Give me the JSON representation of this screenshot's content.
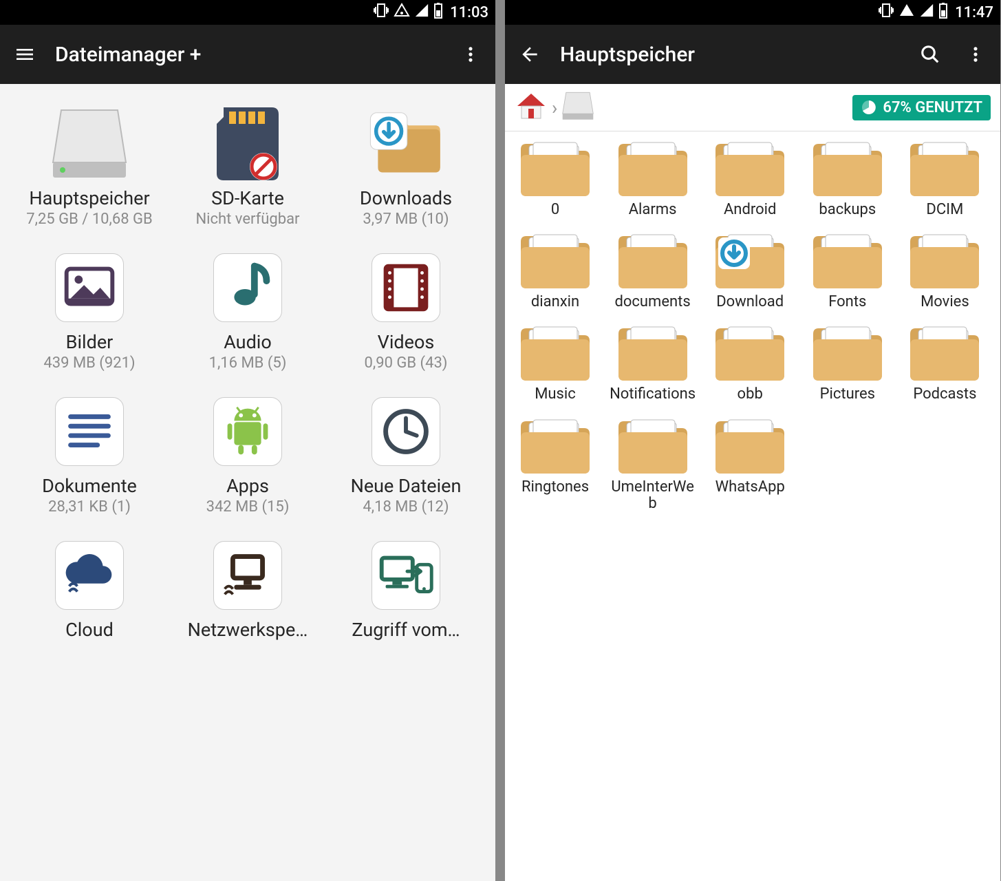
{
  "left": {
    "status": {
      "time": "11:03"
    },
    "header": {
      "title": "Dateimanager +"
    },
    "categories": [
      {
        "title": "Hauptspeicher",
        "sub": "7,25 GB / 10,68 GB",
        "icon": "drive"
      },
      {
        "title": "SD-Karte",
        "sub": "Nicht verfügbar",
        "icon": "sdcard"
      },
      {
        "title": "Downloads",
        "sub": "3,97 MB (10)",
        "icon": "download-folder"
      },
      {
        "title": "Bilder",
        "sub": "439 MB (921)",
        "icon": "image",
        "tile": true,
        "color": "#4d3a5a"
      },
      {
        "title": "Audio",
        "sub": "1,16 MB (5)",
        "icon": "music",
        "tile": true,
        "color": "#2a6e70"
      },
      {
        "title": "Videos",
        "sub": "0,90 GB (43)",
        "icon": "video",
        "tile": true,
        "color": "#7a1f1f"
      },
      {
        "title": "Dokumente",
        "sub": "28,31 KB (1)",
        "icon": "doc",
        "tile": true,
        "color": "#3a5a98"
      },
      {
        "title": "Apps",
        "sub": "342 MB (15)",
        "icon": "android",
        "tile": true,
        "color": "#8bc34a"
      },
      {
        "title": "Neue Dateien",
        "sub": "4,18 MB (12)",
        "icon": "clock",
        "tile": true,
        "color": "#3d4a56"
      },
      {
        "title": "Cloud",
        "sub": "",
        "icon": "cloud",
        "tile": true,
        "color": "#2c4a7a"
      },
      {
        "title": "Netzwerkspe…",
        "sub": "",
        "icon": "netstore",
        "tile": true,
        "color": "#3a2a1f"
      },
      {
        "title": "Zugriff vom…",
        "sub": "",
        "icon": "remote",
        "tile": true,
        "color": "#2a6e5a"
      }
    ]
  },
  "right": {
    "status": {
      "time": "11:47"
    },
    "header": {
      "title": "Hauptspeicher"
    },
    "usage_badge": "67% GENUTZT",
    "folders": [
      {
        "label": "0"
      },
      {
        "label": "Alarms"
      },
      {
        "label": "Android"
      },
      {
        "label": "backups"
      },
      {
        "label": "DCIM"
      },
      {
        "label": "dianxin"
      },
      {
        "label": "documents"
      },
      {
        "label": "Download",
        "download": true
      },
      {
        "label": "Fonts"
      },
      {
        "label": "Movies"
      },
      {
        "label": "Music"
      },
      {
        "label": "Notifications"
      },
      {
        "label": "obb"
      },
      {
        "label": "Pictures"
      },
      {
        "label": "Podcasts"
      },
      {
        "label": "Ringtones"
      },
      {
        "label": "UmeInterWeb"
      },
      {
        "label": "WhatsApp"
      }
    ]
  }
}
